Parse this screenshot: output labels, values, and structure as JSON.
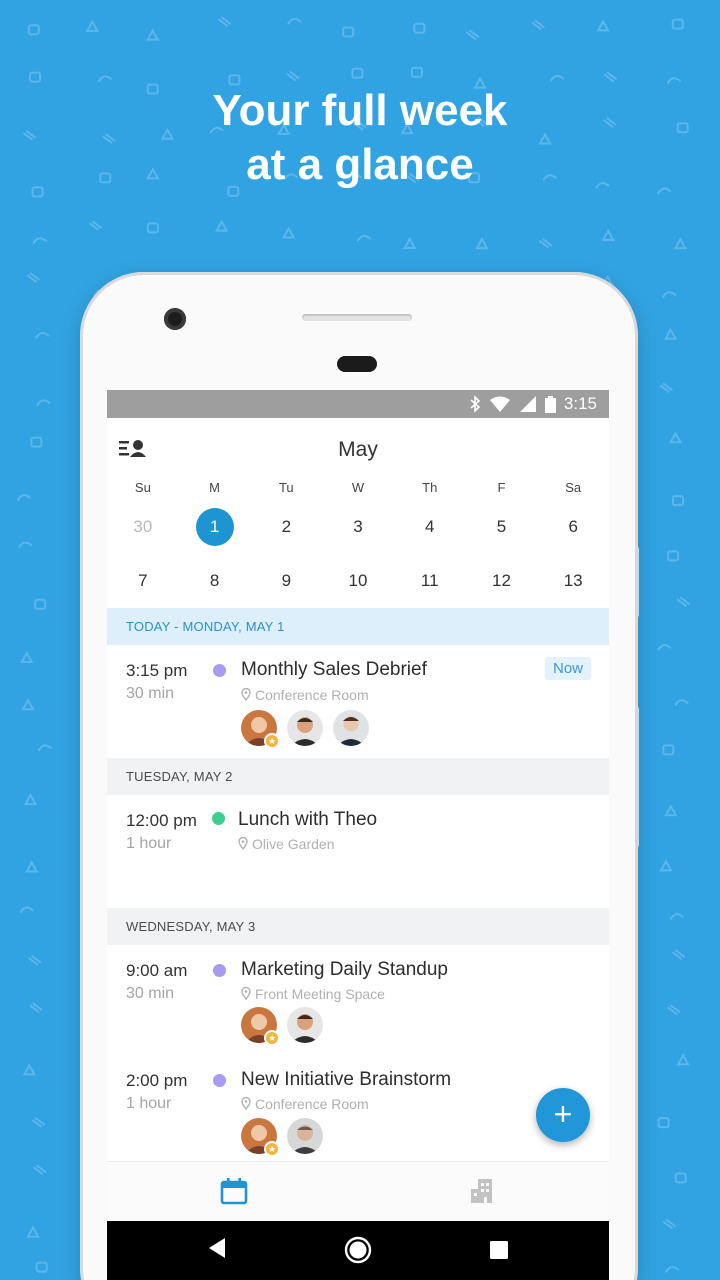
{
  "promo": {
    "headline_line1": "Your full week",
    "headline_line2": "at a glance"
  },
  "status_bar": {
    "time": "3:15",
    "icons": [
      "bluetooth-icon",
      "wifi-icon",
      "signal-icon",
      "battery-icon"
    ]
  },
  "calendar": {
    "month": "May",
    "weekdays": [
      "Su",
      "M",
      "Tu",
      "W",
      "Th",
      "F",
      "Sa"
    ],
    "weeks": [
      [
        {
          "day": "30",
          "muted": true
        },
        {
          "day": "1",
          "selected": true
        },
        {
          "day": "2"
        },
        {
          "day": "3"
        },
        {
          "day": "4"
        },
        {
          "day": "5"
        },
        {
          "day": "6"
        }
      ],
      [
        {
          "day": "7"
        },
        {
          "day": "8"
        },
        {
          "day": "9"
        },
        {
          "day": "10"
        },
        {
          "day": "11"
        },
        {
          "day": "12"
        },
        {
          "day": "13"
        }
      ]
    ]
  },
  "agenda": {
    "today_header": "TODAY - MONDAY, MAY 1",
    "tuesday_header": "TUESDAY, MAY 2",
    "wednesday_header": "WEDNESDAY, MAY 3",
    "events": [
      {
        "time": "3:15 pm",
        "duration": "30 min",
        "title": "Monthly Sales Debrief",
        "location": "Conference Room",
        "dot_color": "#a99bf2",
        "badge": "Now"
      },
      {
        "time": "12:00 pm",
        "duration": "1 hour",
        "title": "Lunch with Theo",
        "location": "Olive Garden",
        "dot_color": "#3ecf8e"
      },
      {
        "time": "9:00 am",
        "duration": "30 min",
        "title": "Marketing Daily Standup",
        "location": "Front Meeting Space",
        "dot_color": "#a99bf2"
      },
      {
        "time": "2:00 pm",
        "duration": "1 hour",
        "title": "New Initiative Brainstorm",
        "location": "Conference Room",
        "dot_color": "#a99bf2"
      }
    ]
  },
  "fab": {
    "label": "+"
  },
  "bottom_nav": {
    "items": [
      {
        "icon": "calendar-icon",
        "active": true
      },
      {
        "icon": "building-icon",
        "active": false
      }
    ]
  },
  "colors": {
    "background": "#32a3e2",
    "accent": "#1e94d2",
    "today_header_bg": "#ddeffa"
  }
}
